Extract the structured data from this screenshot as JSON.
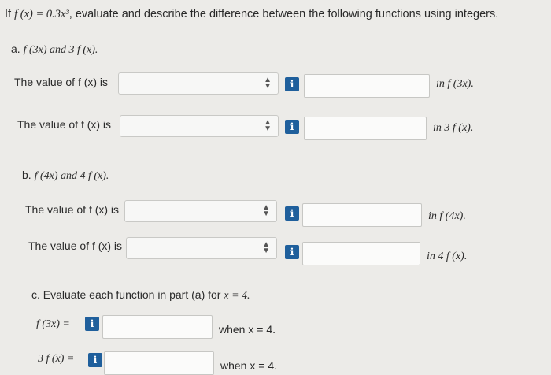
{
  "question": {
    "prefix": "If ",
    "function": "f (x) = 0.3x³",
    "suffix": ", evaluate and describe the difference between the following functions using integers."
  },
  "part_a": {
    "label": "a.",
    "expr": "f (3x) and 3 f (x).",
    "row1": {
      "prompt": "The value of f (x) is",
      "suffix": "in f (3x)."
    },
    "row2": {
      "prompt": "The value of f (x) is",
      "suffix": "in 3 f (x)."
    }
  },
  "part_b": {
    "label": "b.",
    "expr": "f (4x) and 4 f (x).",
    "row1": {
      "prompt": "The value of f (x) is",
      "suffix": "in f (4x)."
    },
    "row2": {
      "prompt": "The value of f (x) is",
      "suffix": "in 4 f (x)."
    }
  },
  "part_c": {
    "label": "c.",
    "text": "Evaluate each function in part (a) for",
    "condition": "x = 4.",
    "row1": {
      "expr": "f (3x) =",
      "suffix": "when x = 4."
    },
    "row2": {
      "expr": "3 f (x) =",
      "suffix": "when x = 4."
    }
  },
  "info_glyph": "i",
  "icons": {
    "select_chevron": "up-down-chevron-icon",
    "info": "info-icon"
  },
  "colors": {
    "info_button": "#1f5f9c",
    "background": "#ecebe8"
  }
}
